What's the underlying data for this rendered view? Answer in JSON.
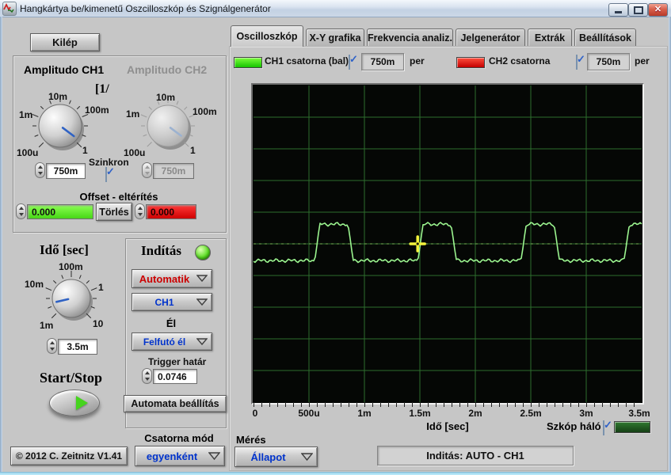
{
  "window": {
    "title": "Hangkártya be/kimenetű Oszcilloszkóp és Szignálgenerátor"
  },
  "tabs": [
    {
      "label": "Oscilloszkóp",
      "active": true
    },
    {
      "label": "X-Y grafika",
      "active": false
    },
    {
      "label": "Frekvencia analiz.",
      "active": false
    },
    {
      "label": "Jelgenerátor",
      "active": false
    },
    {
      "label": "Extrák",
      "active": false
    },
    {
      "label": "Beállítások",
      "active": false
    }
  ],
  "left": {
    "exit_button": "Kilép",
    "amplitude": {
      "title_ch1": "Amplitudo CH1",
      "title_ch2": "Amplitudo CH2",
      "scale_prefix": "[1/",
      "knob_ticks": [
        "1m",
        "10m",
        "100m",
        "100u",
        "1"
      ],
      "ch1_value": "750m",
      "ch2_value": "750m",
      "szinkron_label": "Szinkron",
      "offset_title": "Offset - eltérítés",
      "offset_ch1": "0.000",
      "offset_clear": "Törlés",
      "offset_ch2": "0.000",
      "offset_ch1_bg": "#5ce62e",
      "offset_ch2_bg": "#e60000"
    },
    "time": {
      "title": "Idő [sec]",
      "knob_ticks": [
        "100m",
        "10m",
        "1",
        "1m",
        "10"
      ],
      "value": "3.5m"
    },
    "trigger": {
      "title": "Indítás",
      "led_color": "#44dd22",
      "mode": "Automatik",
      "mode_color": "#cc0000",
      "source": "CH1",
      "source_color": "#0033cc",
      "edge_label": "Él",
      "edge": "Felfutó él",
      "level_label": "Trigger határ",
      "level": "0.0746",
      "auto_button": "Automata beállítás"
    },
    "startstop": {
      "title": "Start/Stop"
    },
    "channel_mode_label": "Csatorna mód",
    "channel_mode_value": "egyenként",
    "copyright": "© 2012   C. Zeitnitz V1.41"
  },
  "scope_header": {
    "ch1_label": "CH1 csatorna (bal)",
    "ch1_color": "#33dd00",
    "ch1_per": "750m",
    "ch1_per_label": "per",
    "ch2_label": "CH2 csatorna",
    "ch2_color": "#dd1100",
    "ch2_per": "750m",
    "ch2_per_label": "per"
  },
  "scope_footer": {
    "x_label": "Idő [sec]",
    "grid_toggle_label": "Szkóp háló",
    "grid_swatch_color": "#1c521c",
    "meres_label": "Mérés",
    "allapot_value": "Állapot",
    "status_value": "Inditás: AUTO - CH1"
  },
  "chart_data": {
    "type": "line",
    "title": "CH1 oscilloscope trace - square wave",
    "xlabel": "Idő [sec]",
    "x_tick_labels": [
      "0",
      "500u",
      "1m",
      "1.5m",
      "2m",
      "2.5m",
      "3m",
      "3.5m"
    ],
    "x_range_ms": [
      0,
      3.5
    ],
    "x_divisions": 7,
    "y_divisions": 10,
    "volts_per_div": "750m",
    "grid_on": true,
    "grid_color": "#2d6e2d",
    "bg_color": "#050705",
    "trace_color": "#9bf48f",
    "series": [
      {
        "name": "CH1 csatorna (bal)",
        "low_div": -0.53,
        "high_div": 0.62,
        "rise_ms": [
          0.55,
          1.48,
          2.41,
          3.34
        ],
        "fall_ms": [
          0.9,
          1.83,
          2.76,
          3.69
        ],
        "edge_ms": 0.05
      }
    ],
    "trigger": {
      "t_ms": 1.48,
      "level_div": 0.0,
      "level_value": 0.0746,
      "marker_color": "#f4f43c"
    }
  }
}
